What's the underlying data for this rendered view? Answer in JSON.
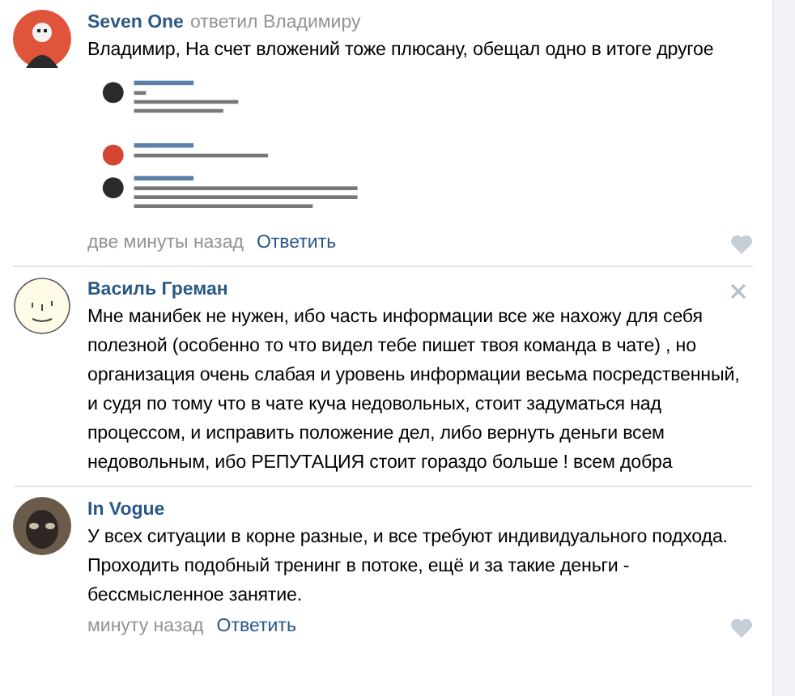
{
  "comments": [
    {
      "author": "Seven One",
      "reply_to": "ответил Владимиру",
      "text": "Владимир, На счет вложений тоже плюсану, обещал одно в итоге другое",
      "time": "две минуты назад",
      "reply": "Ответить",
      "deletable": false
    },
    {
      "author": "Василь Греман",
      "text": "Мне манибек не нужен, ибо часть информации все же нахожу для себя полезной (особенно то что видел тебе пишет твоя команда в чате) , но организация очень слабая и уровень информации весьма посредственный, и судя по тому что в чате куча недовольных, стоит задуматься над процессом, и исправить положение дел, либо вернуть деньги всем недовольным, ибо РЕПУТАЦИЯ стоит гораздо больше ! всем добра",
      "deletable": true
    },
    {
      "author": "In Vogue",
      "text": "У всех ситуации в корне разные, и все требуют индивидуального подхода. Проходить подобный тренинг в потоке, ещё и за такие деньги - бессмысленное занятие.",
      "time": "минуту назад",
      "reply": "Ответить",
      "deletable": false
    }
  ]
}
